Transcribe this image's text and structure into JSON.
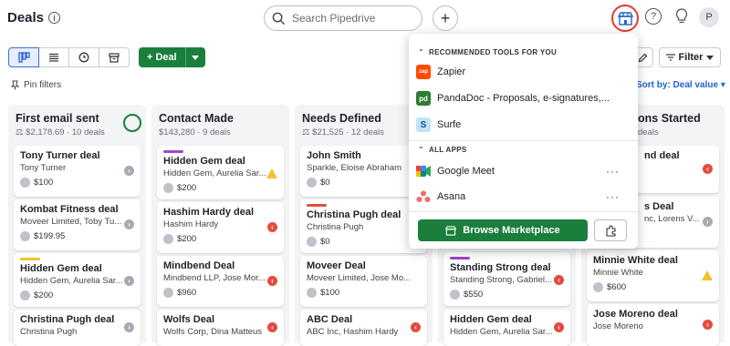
{
  "header": {
    "title": "Deals",
    "search_placeholder": "Search Pipedrive",
    "avatar_initial": "P"
  },
  "toolbar": {
    "new_deal_label": "+ Deal",
    "filter_label": "Filter",
    "pin_filters_label": "Pin filters",
    "sort_label": "Sort by: Deal value"
  },
  "columns": [
    {
      "title": "First email sent",
      "value": "$2,178.69",
      "count": "10 deals",
      "cards": [
        {
          "title": "Tony Turner deal",
          "sub": "Tony Turner",
          "value": "$100",
          "status": "grey",
          "bar": ""
        },
        {
          "title": "Kombat Fitness deal",
          "sub": "Moveer Limited, Toby Tu...",
          "value": "$199.95",
          "status": "grey",
          "bar": ""
        },
        {
          "title": "Hidden Gem deal",
          "sub": "Hidden Gem, Aurelia Sar...",
          "value": "$200",
          "status": "grey",
          "bar": "#f2c12e"
        },
        {
          "title": "Christina Pugh deal",
          "sub": "Christina Pugh",
          "value": "",
          "status": "grey",
          "bar": ""
        }
      ]
    },
    {
      "title": "Contact Made",
      "value": "$143,280",
      "count": "9 deals",
      "cards": [
        {
          "title": "Hidden Gem deal",
          "sub": "Hidden Gem, Aurelia Sar...",
          "value": "$200",
          "status": "warn",
          "bar": "#a542c9"
        },
        {
          "title": "Hashim Hardy deal",
          "sub": "Hashim Hardy",
          "value": "$200",
          "status": "red",
          "bar": ""
        },
        {
          "title": "Mindbend Deal",
          "sub": "Mindbend LLP, Jose Mor...",
          "value": "$960",
          "status": "red",
          "bar": ""
        },
        {
          "title": "Wolfs Deal",
          "sub": "Wolfs Corp, Dina Matteus",
          "value": "",
          "status": "red",
          "bar": ""
        }
      ]
    },
    {
      "title": "Needs Defined",
      "value": "$21,525",
      "count": "12 deals",
      "cards": [
        {
          "title": "John Smith",
          "sub": "Sparkle, Eloise Abraham",
          "value": "$0",
          "status": "",
          "bar": ""
        },
        {
          "title": "Christina Pugh deal",
          "sub": "Christina Pugh",
          "value": "$0",
          "status": "",
          "bar": "#e54b3c"
        },
        {
          "title": "Moveer Deal",
          "sub": "Moveer Limited, Jose Mo...",
          "value": "$100",
          "status": "",
          "bar": ""
        },
        {
          "title": "ABC Deal",
          "sub": "ABC Inc, Hashim Hardy",
          "value": "",
          "status": "red",
          "bar": ""
        }
      ]
    },
    {
      "title": "",
      "value": "",
      "count": "",
      "cards": [
        {
          "title": "Standing Strong deal",
          "sub": "Standing Strong, Gabriel...",
          "value": "$550",
          "status": "red",
          "bar": "#a542c9"
        },
        {
          "title": "Hidden Gem deal",
          "sub": "Hidden Gem, Aurelia Sar...",
          "value": "",
          "status": "red",
          "bar": ""
        }
      ]
    },
    {
      "title": "ons Started",
      "value": "",
      "count": "deals",
      "cards": [
        {
          "title": "nd deal",
          "sub": "",
          "value": "",
          "status": "red",
          "bar": ""
        },
        {
          "title": "s Deal",
          "sub": "nc, Lorens V...",
          "value": "",
          "status": "grey",
          "bar": ""
        },
        {
          "title": "Minnie White deal",
          "sub": "Minnie White",
          "value": "$600",
          "status": "warn",
          "bar": ""
        },
        {
          "title": "Jose Moreno deal",
          "sub": "Jose Moreno",
          "value": "",
          "status": "red",
          "bar": ""
        }
      ]
    }
  ],
  "marketplace": {
    "recommended_heading": "RECOMMENDED TOOLS FOR YOU",
    "recommended": [
      {
        "name": "Zapier",
        "color": "#ff4a00",
        "logo": "zapier"
      },
      {
        "name": "PandaDoc - Proposals, e-signatures,...",
        "color": "#2e7d32",
        "logo": "pd"
      },
      {
        "name": "Surfe",
        "color": "#bfe6f5",
        "logo": "S"
      }
    ],
    "apps_heading": "ALL APPS",
    "apps": [
      {
        "name": "Google Meet",
        "color": "#00897b",
        "logo": ""
      },
      {
        "name": "Asana",
        "color": "#f06a6a",
        "logo": ""
      }
    ],
    "browse_label": "Browse Marketplace",
    "more_glyph": "···"
  }
}
